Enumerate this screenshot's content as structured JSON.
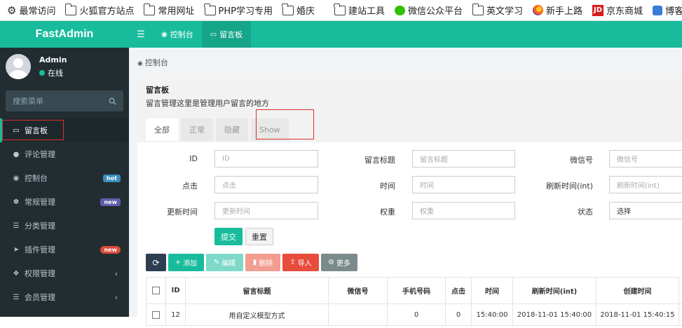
{
  "bookmarks": [
    {
      "icon": "gear-icon",
      "label": "最常访问"
    },
    {
      "icon": "folder-icon",
      "label": "火狐官方站点"
    },
    {
      "icon": "folder-icon",
      "label": "常用网址"
    },
    {
      "icon": "folder-icon",
      "label": "PHP学习专用"
    },
    {
      "icon": "folder-icon",
      "label": "婚庆"
    },
    {
      "icon": "folder-icon",
      "label": "建站工具"
    },
    {
      "icon": "wechat-icon",
      "label": "微信公众平台"
    },
    {
      "icon": "folder-icon",
      "label": "英文学习"
    },
    {
      "icon": "firefox-icon",
      "label": "新手上路"
    },
    {
      "icon": "jd-icon",
      "label": "京东商城"
    },
    {
      "icon": "cnblogs-icon",
      "label": "博客园_Cch."
    }
  ],
  "sidebar": {
    "logo": "FastAdmin",
    "user": {
      "name": "Admin",
      "status": "在线"
    },
    "search_placeholder": "搜索菜单",
    "items": [
      {
        "label": "留言板",
        "icon": "▭",
        "badge": ""
      },
      {
        "label": "评论管理",
        "icon": "●",
        "badge": ""
      },
      {
        "label": "控制台",
        "icon": "◉",
        "badge": "hot"
      },
      {
        "label": "常规管理",
        "icon": "✽",
        "badge": "new"
      },
      {
        "label": "分类管理",
        "icon": "☰",
        "badge": ""
      },
      {
        "label": "插件管理",
        "icon": "➤",
        "badge": "new"
      },
      {
        "label": "权限管理",
        "icon": "❖",
        "badge": ""
      },
      {
        "label": "会员管理",
        "icon": "☰",
        "badge": ""
      }
    ]
  },
  "topbar": {
    "menu_icon": "☰",
    "tabs": [
      {
        "label": "控制台",
        "icon": "◉"
      },
      {
        "label": "留言板",
        "icon": "▭"
      }
    ]
  },
  "breadcrumb": "控制台",
  "panel": {
    "title": "留言板",
    "description": "留言管理这里是管理用户留言的地方",
    "tabs": [
      "全部",
      "正常",
      "隐藏",
      "Show"
    ]
  },
  "form": {
    "fields": [
      {
        "label": "ID",
        "placeholder": "ID"
      },
      {
        "label": "留言标题",
        "placeholder": "留言标题"
      },
      {
        "label": "微信号",
        "placeholder": "微信号"
      },
      {
        "label": "点击",
        "placeholder": "点击"
      },
      {
        "label": "时间",
        "placeholder": "时间"
      },
      {
        "label": "刷新时间(int)",
        "placeholder": "刷新时间(int)"
      },
      {
        "label": "更新时间",
        "placeholder": "更新时间"
      },
      {
        "label": "权重",
        "placeholder": "权重"
      },
      {
        "label": "状态",
        "placeholder": "选择"
      }
    ],
    "submit": "提交",
    "reset": "重置"
  },
  "toolbar": {
    "refresh_icon": "⟳",
    "add": "添加",
    "edit": "编辑",
    "delete": "删除",
    "import": "导入",
    "more": "更多"
  },
  "table": {
    "headers": [
      "ID",
      "留言标题",
      "微信号",
      "手机号码",
      "点击",
      "时间",
      "刷新时间(int)",
      "创建时间"
    ],
    "rows": [
      [
        "12",
        "用自定义模型方式",
        "",
        "0",
        "0",
        "15:40:00",
        "2018-11-01 15:40:00",
        "2018-11-01 15:40:15"
      ]
    ]
  },
  "colors": {
    "primary": "#18bc9c",
    "sidebar": "#222d32",
    "danger": "#dd4b39",
    "highlight_box": "#d9302c"
  }
}
